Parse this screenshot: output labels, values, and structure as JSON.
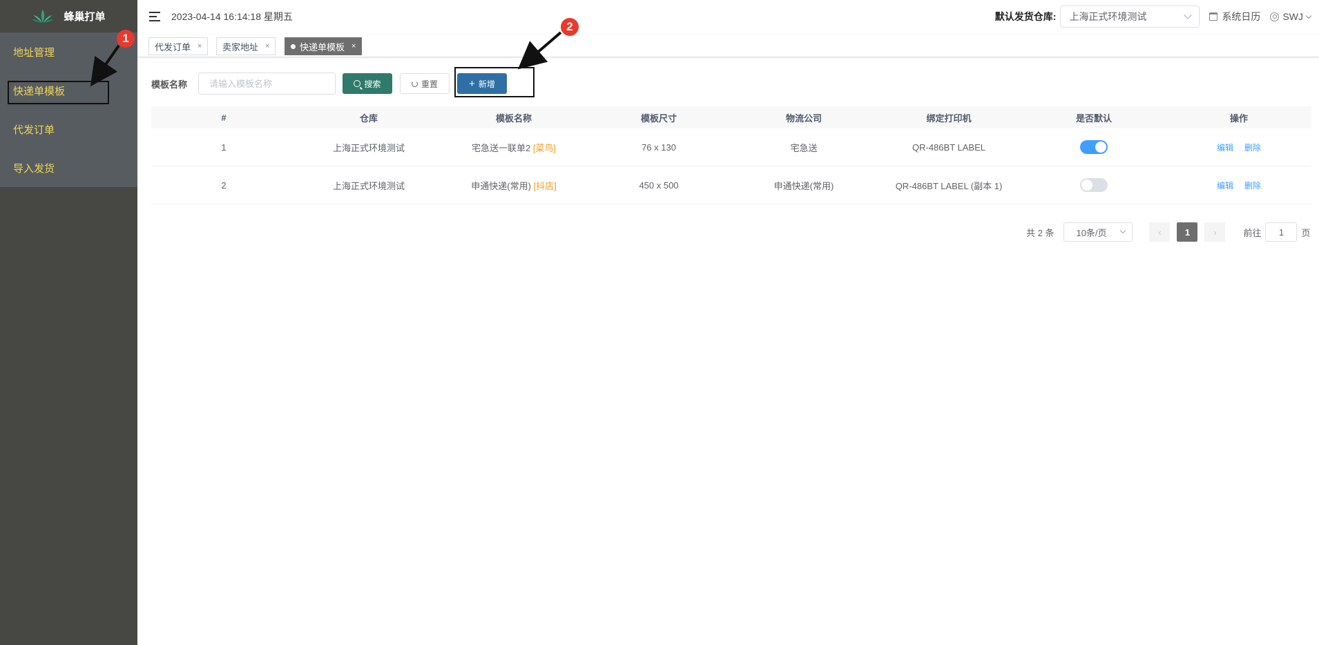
{
  "sidebar": {
    "app_name": "蜂巢打单",
    "items": [
      {
        "label": "地址管理"
      },
      {
        "label": "快递单模板"
      },
      {
        "label": "代发订单"
      },
      {
        "label": "导入发货"
      }
    ]
  },
  "header": {
    "datetime": "2023-04-14 16:14:18 星期五",
    "warehouse_label": "默认发货仓库:",
    "warehouse_value": "上海正式环境测试",
    "calendar_label": "系统日历",
    "user_name": "SWJ"
  },
  "tags": [
    {
      "label": "代发订单",
      "active": false
    },
    {
      "label": "卖家地址",
      "active": false
    },
    {
      "label": "快递单模板",
      "active": true
    }
  ],
  "search": {
    "label": "模板名称",
    "placeholder": "请输入模板名称",
    "search_button": "搜索",
    "reset_button": "重置",
    "add_button": "新增"
  },
  "table": {
    "columns": [
      "#",
      "仓库",
      "模板名称",
      "模板尺寸",
      "物流公司",
      "绑定打印机",
      "是否默认",
      "操作"
    ],
    "rows": [
      {
        "index": "1",
        "warehouse": "上海正式环境测试",
        "template_name": "宅急送一联单2",
        "template_tag": "[菜鸟]",
        "size": "76 x 130",
        "carrier": "宅急送",
        "printer": "QR-486BT LABEL",
        "is_default": true,
        "edit": "编辑",
        "delete": "删除"
      },
      {
        "index": "2",
        "warehouse": "上海正式环境测试",
        "template_name": "申通快递(常用)",
        "template_tag": "[抖店]",
        "size": "450 x 500",
        "carrier": "申通快递(常用)",
        "printer": "QR-486BT LABEL (副本 1)",
        "is_default": false,
        "edit": "编辑",
        "delete": "删除"
      }
    ]
  },
  "pagination": {
    "total": "共 2 条",
    "page_size": "10条/页",
    "current_page": "1",
    "goto_prefix": "前往",
    "goto_value": "1",
    "goto_suffix": "页"
  },
  "annotations": {
    "badge1": "1",
    "badge2": "2"
  },
  "colors": {
    "sidebar_bg": "#474744",
    "menu_text": "#f0d458",
    "search_btn": "#2f7a6a",
    "add_btn": "#2e6fa6",
    "tag_orange": "#f39a1e",
    "badge_red": "#e8392c"
  }
}
